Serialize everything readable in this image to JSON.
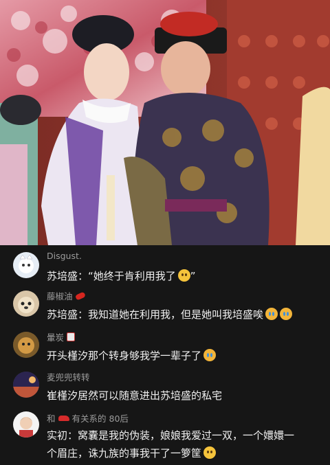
{
  "video": {
    "scene": "palace-drama-still"
  },
  "comments": [
    {
      "username": "Disgust.",
      "badge": "",
      "text": "苏培盛：“她终于肯利用我了",
      "text_after": "”",
      "emoji": "hug-face-icon"
    },
    {
      "username": "藤椒油",
      "badge": "chili-icon",
      "text": "苏培盛：我知道她在利用我，但是她叫我培盛唉",
      "text_after": "",
      "emoji": "crying-face-icon"
    },
    {
      "username": "暈炭",
      "badge": "badge-icon",
      "text": "开头槿汐那个转身够我学一辈子了",
      "text_after": "",
      "emoji": "teary-face-icon"
    },
    {
      "username": "麦兜兜转转",
      "badge": "",
      "text": "崔槿汐居然可以随意进出苏培盛的私宅",
      "text_after": "",
      "emoji": ""
    },
    {
      "username": "和",
      "username_suffix": "有关系的 80后",
      "badge": "car-icon",
      "text": "实初：窝囊是我的伪装，娘娘我爱过一双，一个嬛嬛一",
      "text_line2": "个眉庄，诛九族的事我干了一箩筐",
      "emoji": "laughing-face-icon"
    }
  ]
}
